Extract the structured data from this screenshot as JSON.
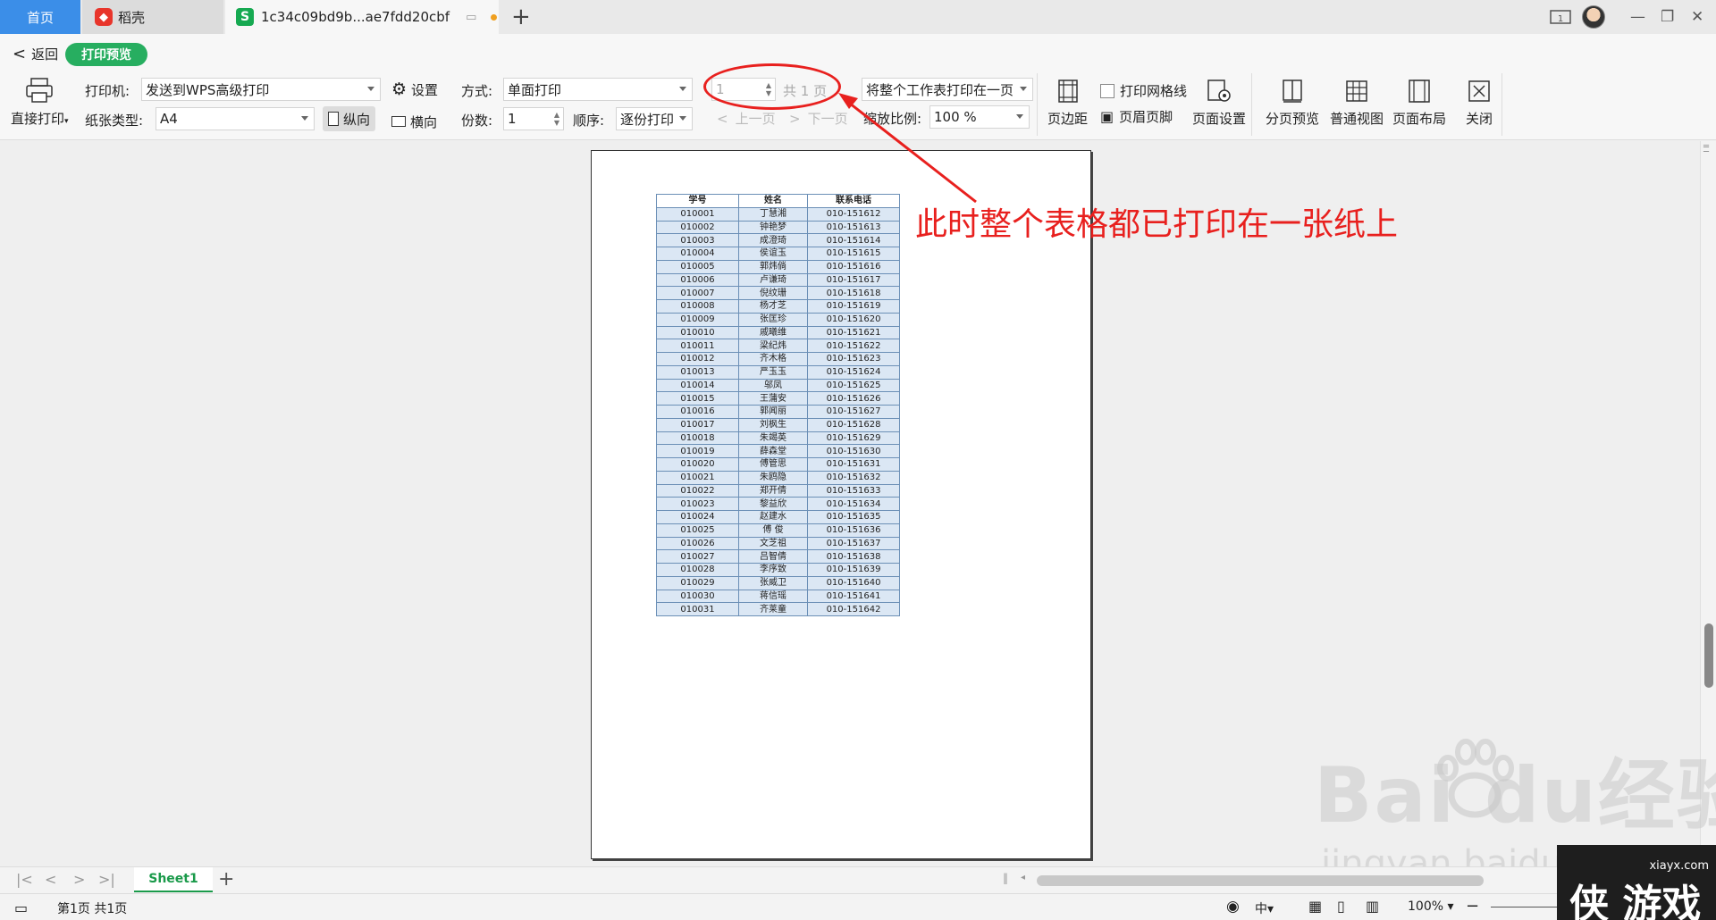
{
  "tabs": {
    "home": "首页",
    "daoke": "稻壳",
    "file": "1c34c09bd9b...ae7fdd20cbf"
  },
  "toolbar": {
    "back": "返回",
    "mode": "打印预览",
    "direct_print": "直接打印",
    "printer_label": "打印机:",
    "printer_value": "发送到WPS高级打印",
    "settings": "设置",
    "paper_label": "纸张类型:",
    "paper_value": "A4",
    "portrait": "纵向",
    "landscape": "横向",
    "method_label": "方式:",
    "method_value": "单面打印",
    "copies_label": "份数:",
    "copies_value": "1",
    "order_label": "顺序:",
    "order_value": "逐份打印",
    "page_input": "1",
    "page_total": "共 1 页",
    "prev_page": "上一页",
    "next_page": "下一页",
    "fit_value": "将整个工作表打印在一页",
    "scale_label": "缩放比例:",
    "scale_value": "100 %",
    "margins": "页边距",
    "gridlines": "打印网格线",
    "header_footer": "页眉页脚",
    "page_setup": "页面设置",
    "page_break_preview": "分页预览",
    "normal_view": "普通视图",
    "page_layout": "页面布局",
    "close": "关闭"
  },
  "annotation": "此时整个表格都已打印在一张纸上",
  "table": {
    "headers": [
      "学号",
      "姓名",
      "联系电话"
    ],
    "rows": [
      [
        "010001",
        "丁慧湘",
        "010-151612"
      ],
      [
        "010002",
        "钟艳梦",
        "010-151613"
      ],
      [
        "010003",
        "成澄琦",
        "010-151614"
      ],
      [
        "010004",
        "侯谊玉",
        "010-151615"
      ],
      [
        "010005",
        "郭炜倘",
        "010-151616"
      ],
      [
        "010006",
        "卢谦琦",
        "010-151617"
      ],
      [
        "010007",
        "倪纹珊",
        "010-151618"
      ],
      [
        "010008",
        "杨才芝",
        "010-151619"
      ],
      [
        "010009",
        "张匡珍",
        "010-151620"
      ],
      [
        "010010",
        "戚曦维",
        "010-151621"
      ],
      [
        "010011",
        "梁纪炜",
        "010-151622"
      ],
      [
        "010012",
        "齐木格",
        "010-151623"
      ],
      [
        "010013",
        "严玉玉",
        "010-151624"
      ],
      [
        "010014",
        "邬凤",
        "010-151625"
      ],
      [
        "010015",
        "王蒲安",
        "010-151626"
      ],
      [
        "010016",
        "郭闻丽",
        "010-151627"
      ],
      [
        "010017",
        "刘枫生",
        "010-151628"
      ],
      [
        "010018",
        "朱竭英",
        "010-151629"
      ],
      [
        "010019",
        "薛森堂",
        "010-151630"
      ],
      [
        "010020",
        "傅管思",
        "010-151631"
      ],
      [
        "010021",
        "朱鸥隐",
        "010-151632"
      ],
      [
        "010022",
        "郑开倩",
        "010-151633"
      ],
      [
        "010023",
        "黎益欣",
        "010-151634"
      ],
      [
        "010024",
        "赵建水",
        "010-151635"
      ],
      [
        "010025",
        "傅 俊",
        "010-151636"
      ],
      [
        "010026",
        "文芝祖",
        "010-151637"
      ],
      [
        "010027",
        "吕智倩",
        "010-151638"
      ],
      [
        "010028",
        "李序致",
        "010-151639"
      ],
      [
        "010029",
        "张威卫",
        "010-151640"
      ],
      [
        "010030",
        "蒋信瑶",
        "010-151641"
      ],
      [
        "010031",
        "齐莱童",
        "010-151642"
      ]
    ]
  },
  "sheetbar": {
    "sheet_name": "Sheet1"
  },
  "statusbar": {
    "page_info": "第1页 共1页",
    "zoom": "100%"
  },
  "watermark": {
    "baidu": "Bai  du经验",
    "url": "jingyan.baidu.com",
    "site_url": "xiayx.com",
    "site_name": "侠 游戏"
  },
  "colors": {
    "accent_blue": "#3b8ee8",
    "green": "#27ae60",
    "annotation_red": "#e8201e",
    "table_fill": "#dbe7f4"
  }
}
